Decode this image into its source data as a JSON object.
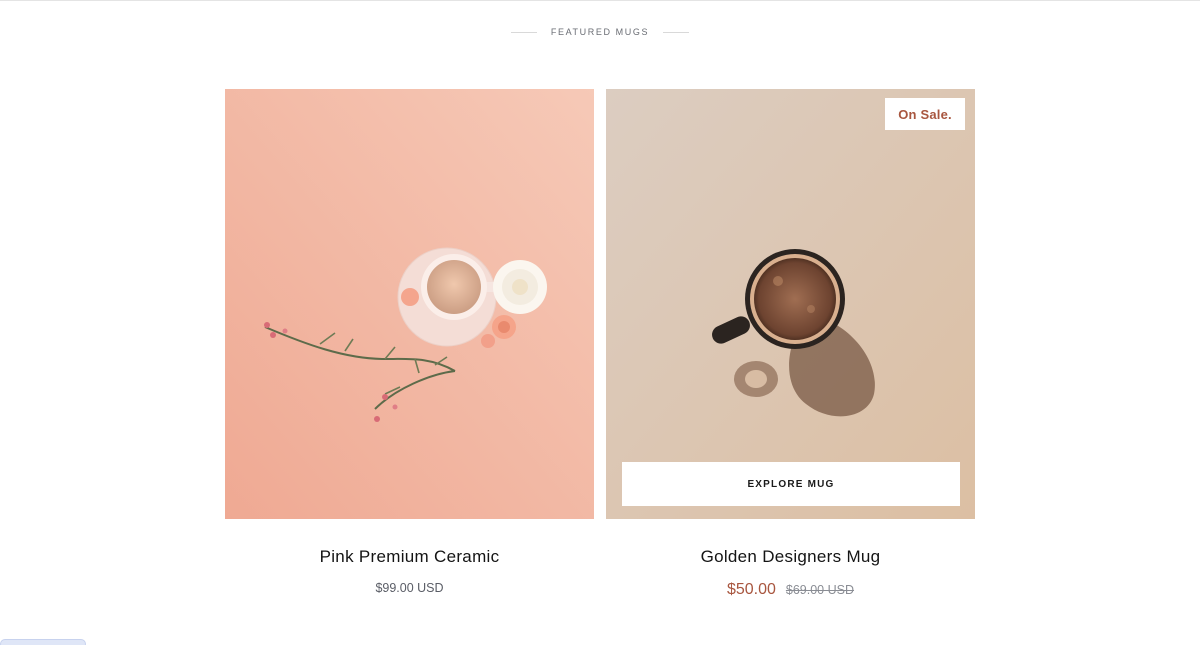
{
  "section": {
    "heading": "FEATURED MUGS"
  },
  "products": [
    {
      "title": "Pink Premium Ceramic",
      "price": "$99.00 USD",
      "image_icon": "coffee-cup-with-flowers-image"
    },
    {
      "title": "Golden Designers Mug",
      "badge": "On Sale.",
      "sale_price": "$50.00",
      "compare_price": "$69.00 USD",
      "cta_label": "EXPLORE MUG",
      "image_icon": "coffee-mug-image"
    }
  ],
  "colors": {
    "accent": "#a8563f",
    "pink_bg": "#f1b39e",
    "beige_bg": "#dcc0a8"
  }
}
